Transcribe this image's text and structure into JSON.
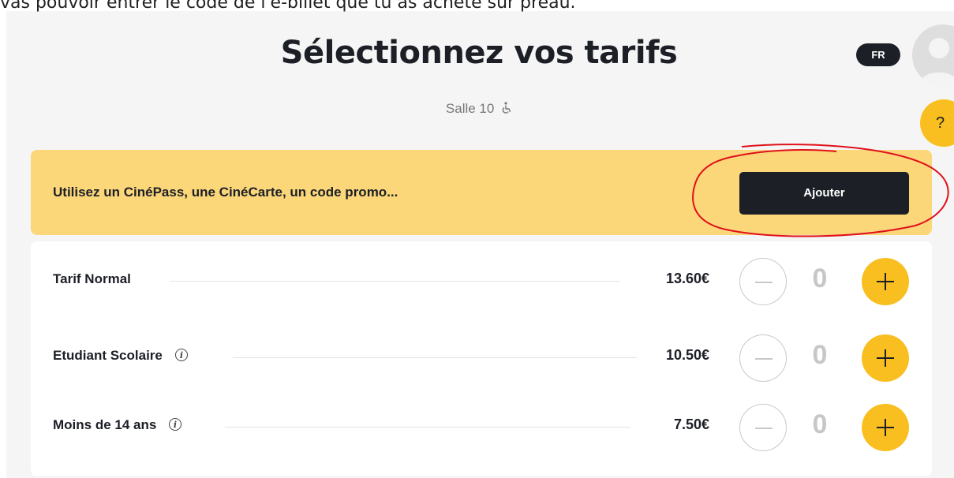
{
  "caption": "vas pouvoir entrer le code de l'e-billet que tu as acheté sur preau.",
  "header": {
    "title": "Sélectionnez vos tarifs",
    "room": "Salle 10",
    "lang": "FR",
    "help": "?"
  },
  "promo": {
    "label": "Utilisez un CinéPass, une CinéCarte, un code promo...",
    "button": "Ajouter"
  },
  "tariffs": [
    {
      "label": "Tarif Normal",
      "price": "13.60€",
      "qty": "0",
      "info": false
    },
    {
      "label": "Etudiant Scolaire",
      "price": "10.50€",
      "qty": "0",
      "info": true
    },
    {
      "label": "Moins de 14 ans",
      "price": "7.50€",
      "qty": "0",
      "info": true
    }
  ],
  "colors": {
    "accent": "#f9bf20",
    "promo_bg": "#fbd77a",
    "dark": "#1c1f26",
    "annotation": "#e0101a"
  },
  "icons": [
    "accessibility-icon",
    "info-icon",
    "minus-icon",
    "plus-icon",
    "avatar-icon"
  ]
}
